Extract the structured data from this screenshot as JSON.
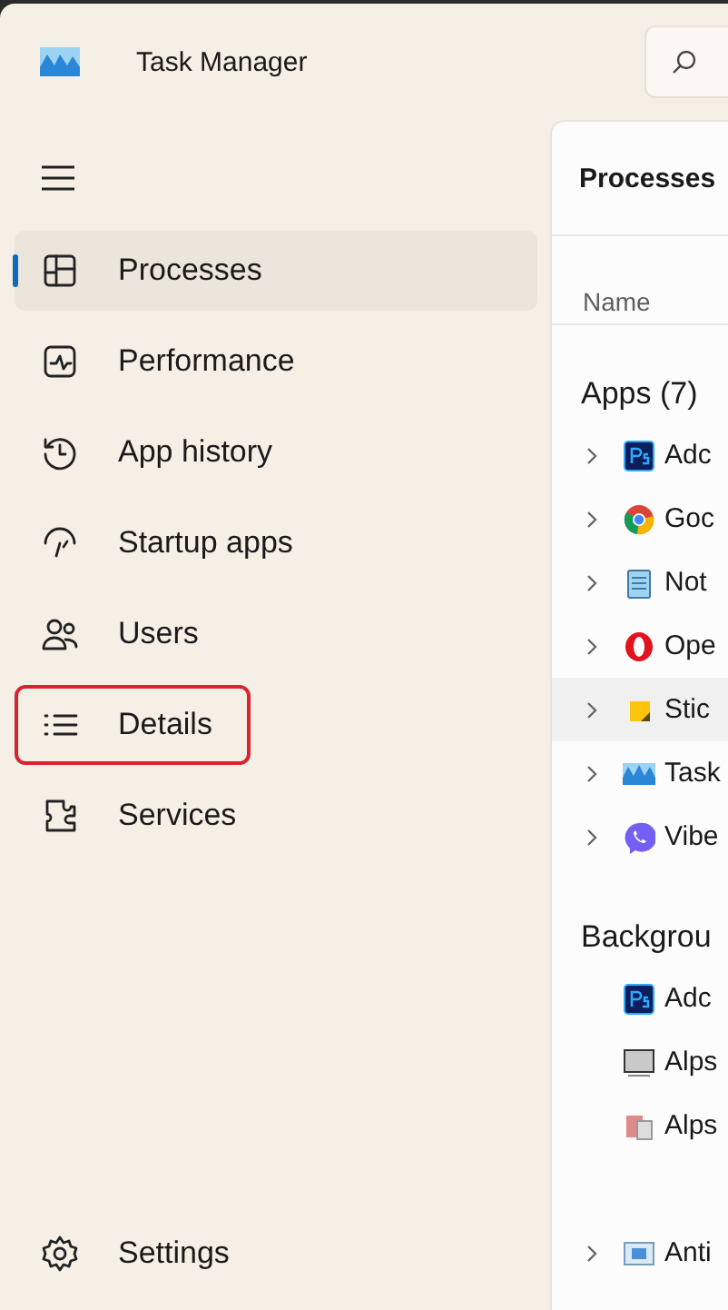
{
  "window": {
    "title": "Task Manager"
  },
  "sidebar": {
    "items": [
      {
        "label": "Processes",
        "kind": "processes",
        "selected": true,
        "highlighted": false
      },
      {
        "label": "Performance",
        "kind": "performance",
        "selected": false,
        "highlighted": false
      },
      {
        "label": "App history",
        "kind": "history",
        "selected": false,
        "highlighted": false
      },
      {
        "label": "Startup apps",
        "kind": "startup",
        "selected": false,
        "highlighted": false
      },
      {
        "label": "Users",
        "kind": "users",
        "selected": false,
        "highlighted": false
      },
      {
        "label": "Details",
        "kind": "details",
        "selected": false,
        "highlighted": true
      },
      {
        "label": "Services",
        "kind": "services",
        "selected": false,
        "highlighted": false
      }
    ],
    "settings": {
      "label": "Settings"
    }
  },
  "panel": {
    "title": "Processes",
    "column": "Name",
    "groups": [
      {
        "title": "Apps (7)",
        "rows": [
          {
            "name": "Adc",
            "kind": "ps",
            "expandable": true,
            "selected": false
          },
          {
            "name": "Goc",
            "kind": "chrome",
            "expandable": true,
            "selected": false
          },
          {
            "name": "Not",
            "kind": "notepad",
            "expandable": true,
            "selected": false
          },
          {
            "name": "Ope",
            "kind": "opera",
            "expandable": true,
            "selected": false
          },
          {
            "name": "Stic",
            "kind": "sticky",
            "expandable": true,
            "selected": true
          },
          {
            "name": "Task",
            "kind": "taskmgr",
            "expandable": true,
            "selected": false
          },
          {
            "name": "Vibe",
            "kind": "viber",
            "expandable": true,
            "selected": false
          }
        ]
      },
      {
        "title": "Backgrou",
        "rows": [
          {
            "name": "Adc",
            "kind": "ps",
            "expandable": false,
            "selected": false
          },
          {
            "name": "Alps",
            "kind": "monitor",
            "expandable": false,
            "selected": false
          },
          {
            "name": "Alps",
            "kind": "app",
            "expandable": false,
            "selected": false
          },
          {
            "name": "Anti",
            "kind": "window",
            "expandable": true,
            "selected": false
          }
        ]
      }
    ]
  }
}
